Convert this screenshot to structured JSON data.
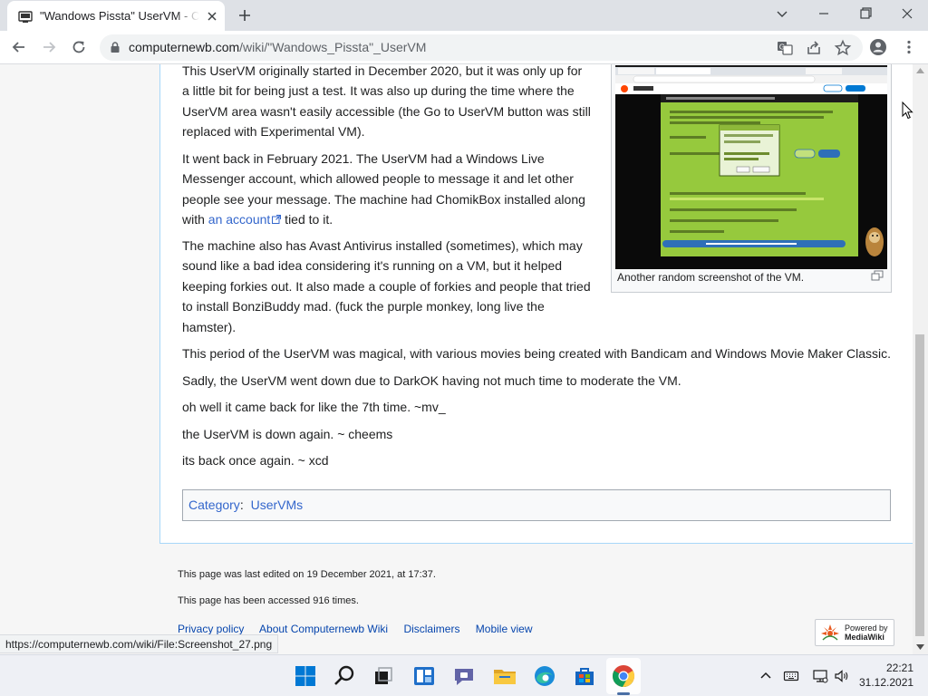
{
  "browser": {
    "tab_title": "\"Wandows Pissta\" UserVM - Computernewb Wiki",
    "url_domain": "computernewb.com",
    "url_path": "/wiki/\"Wandows_Pissta\"_UserVM"
  },
  "article": {
    "p1": "This UserVM originally started in December 2020, but it was only up for a little bit for being just a test. It was also up during the time where the UserVM area wasn't easily accessible (the Go to UserVM button was still replaced with Experimental VM).",
    "p2_before": "It went back in February 2021. The UserVM had a Windows Live Messenger account, which allowed people to message it and let other people see your message. The machine had ChomikBox installed along with ",
    "p2_link": "an account",
    "p2_after": " tied to it.",
    "p3": "The machine also has Avast Antivirus installed (sometimes), which may sound like a bad idea considering it's running on a VM, but it helped keeping forkies out. It also made a couple of forkies and people that tried to install BonziBuddy mad. (fuck the purple monkey, long live the hamster).",
    "p4": "This period of the UserVM was magical, with various movies being created with Bandicam and Windows Movie Maker Classic.",
    "p5": "Sadly, the UserVM went down due to DarkOK having not much time to moderate the VM.",
    "p6": "oh well it came back for like the 7th time. ~mv_",
    "p7": "the UserVM is down again. ~ cheems",
    "p8": "its back once again. ~ xcd"
  },
  "thumbnail": {
    "caption": "Another random screenshot of the VM."
  },
  "categories": {
    "label": "Category",
    "item": "UserVMs"
  },
  "footer": {
    "last_edited": "This page was last edited on 19 December 2021, at 17:37.",
    "accessed": "This page has been accessed 916 times.",
    "links": [
      "Privacy policy",
      "About Computernewb Wiki",
      "Disclaimers",
      "Mobile view"
    ],
    "badge_line1": "Powered by",
    "badge_line2": "MediaWiki"
  },
  "status_bar": "https://computernewb.com/wiki/File:Screenshot_27.png",
  "taskbar": {
    "time": "22:21",
    "date": "31.12.2021"
  }
}
